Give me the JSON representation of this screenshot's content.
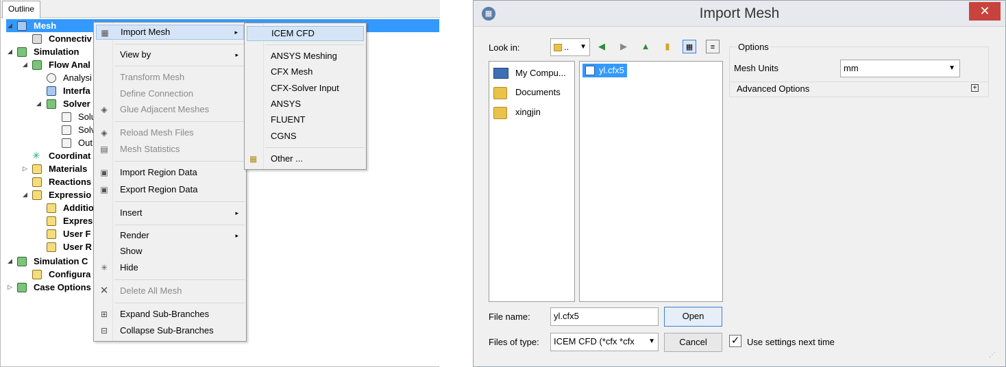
{
  "outline": {
    "tab": "Outline",
    "tree": [
      {
        "label": "Mesh",
        "icon": "mesh-icon",
        "selected": true
      },
      {
        "label": "Connectiv",
        "icon": "connectivity-icon"
      },
      {
        "label": "Simulation",
        "icon": "simulation-icon"
      },
      {
        "label": "Flow Anal",
        "icon": "flow-analysis-icon"
      },
      {
        "label": "Analysi",
        "icon": "clock-icon"
      },
      {
        "label": "Interfa",
        "icon": "interface-icon"
      },
      {
        "label": "Solver",
        "icon": "solver-icon"
      },
      {
        "label": "Solu",
        "icon": "solution-icon"
      },
      {
        "label": "Solv",
        "icon": "solver-control-icon"
      },
      {
        "label": "Out",
        "icon": "output-icon"
      },
      {
        "label": "Coordinat",
        "icon": "coordinate-icon"
      },
      {
        "label": "Materials",
        "icon": "materials-icon"
      },
      {
        "label": "Reactions",
        "icon": "reactions-icon"
      },
      {
        "label": "Expressio",
        "icon": "expressions-icon"
      },
      {
        "label": "Additio",
        "icon": "additional-icon"
      },
      {
        "label": "Expres",
        "icon": "expression-icon"
      },
      {
        "label": "User F",
        "icon": "user-function-icon"
      },
      {
        "label": "User R",
        "icon": "user-routine-icon"
      },
      {
        "label": "Simulation C",
        "icon": "simulation-control-icon"
      },
      {
        "label": "Configura",
        "icon": "configuration-icon"
      },
      {
        "label": "Case Options",
        "icon": "case-options-icon"
      }
    ]
  },
  "context_menu": {
    "items": [
      {
        "label": "Import Mesh",
        "arrow": "▸"
      },
      {
        "label": "View by",
        "arrow": "▸"
      },
      {
        "label": "Transform Mesh"
      },
      {
        "label": "Define Connection"
      },
      {
        "label": "Glue Adjacent Meshes"
      },
      {
        "label": "Reload Mesh Files"
      },
      {
        "label": "Mesh Statistics"
      },
      {
        "label": "Import Region Data"
      },
      {
        "label": "Export Region Data"
      },
      {
        "label": "Insert",
        "arrow": "▸"
      },
      {
        "label": "Render",
        "arrow": "▸"
      },
      {
        "label": "Show"
      },
      {
        "label": "Hide"
      },
      {
        "label": "Delete All Mesh"
      },
      {
        "label": "Expand Sub-Branches"
      },
      {
        "label": "Collapse Sub-Branches"
      }
    ]
  },
  "submenu": {
    "items": [
      {
        "label": "ICEM CFD"
      },
      {
        "label": "ANSYS Meshing"
      },
      {
        "label": "CFX Mesh"
      },
      {
        "label": "CFX-Solver Input"
      },
      {
        "label": "ANSYS"
      },
      {
        "label": "FLUENT"
      },
      {
        "label": "CGNS"
      },
      {
        "label": "Other ..."
      }
    ]
  },
  "dialog": {
    "title": "Import Mesh",
    "close": "✕",
    "look_in_label": "Look in:",
    "look_in_value": "..",
    "places": [
      "My Compu...",
      "Documents",
      "xingjin"
    ],
    "files": [
      "yl.cfx5"
    ],
    "file_name_label": "File name:",
    "file_name_value": "yl.cfx5",
    "files_of_type_label": "Files of type:",
    "files_of_type_value": "ICEM CFD (*cfx *cfx",
    "open_button": "Open",
    "cancel_button": "Cancel",
    "options_title": "Options",
    "mesh_units_label": "Mesh Units",
    "mesh_units_value": "mm",
    "advanced_options": "Advanced Options",
    "use_settings_label": "Use settings next time",
    "use_settings_checked": true
  }
}
